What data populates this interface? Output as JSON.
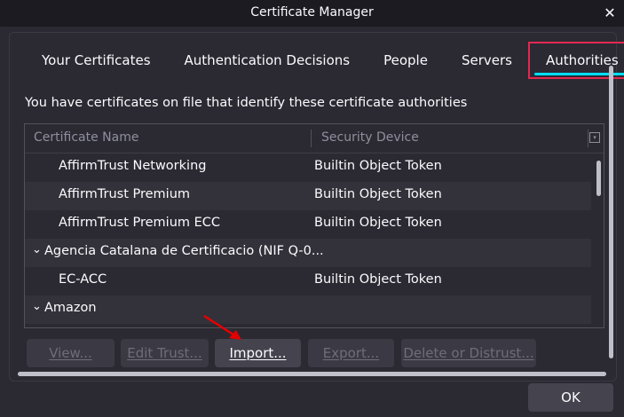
{
  "window": {
    "title": "Certificate Manager"
  },
  "tabs": [
    {
      "label": "Your Certificates"
    },
    {
      "label": "Authentication Decisions"
    },
    {
      "label": "People"
    },
    {
      "label": "Servers"
    },
    {
      "label": "Authorities",
      "selected": true
    }
  ],
  "description": "You have certificates on file that identify these certificate authorities",
  "tree": {
    "columns": [
      "Certificate Name",
      "Security Device"
    ],
    "rows": [
      {
        "name": "AffirmTrust Networking",
        "device": "Builtin Object Token",
        "level": 1
      },
      {
        "name": "AffirmTrust Premium",
        "device": "Builtin Object Token",
        "level": 1
      },
      {
        "name": "AffirmTrust Premium ECC",
        "device": "Builtin Object Token",
        "level": 1
      },
      {
        "name": "Agencia Catalana de Certificacio (NIF Q-0...",
        "device": "",
        "level": 0,
        "expanded": true
      },
      {
        "name": "EC-ACC",
        "device": "Builtin Object Token",
        "level": 1
      },
      {
        "name": "Amazon",
        "device": "",
        "level": 0,
        "expanded": true
      }
    ]
  },
  "buttons": {
    "view": "View...",
    "edit_trust": "Edit Trust...",
    "import": "Import...",
    "export": "Export...",
    "delete": "Delete or Distrust...",
    "ok": "OK"
  },
  "colors": {
    "selected_outline": "#e22850",
    "tab_indicator": "#00ddff",
    "annotation_arrow": "#e60000"
  }
}
